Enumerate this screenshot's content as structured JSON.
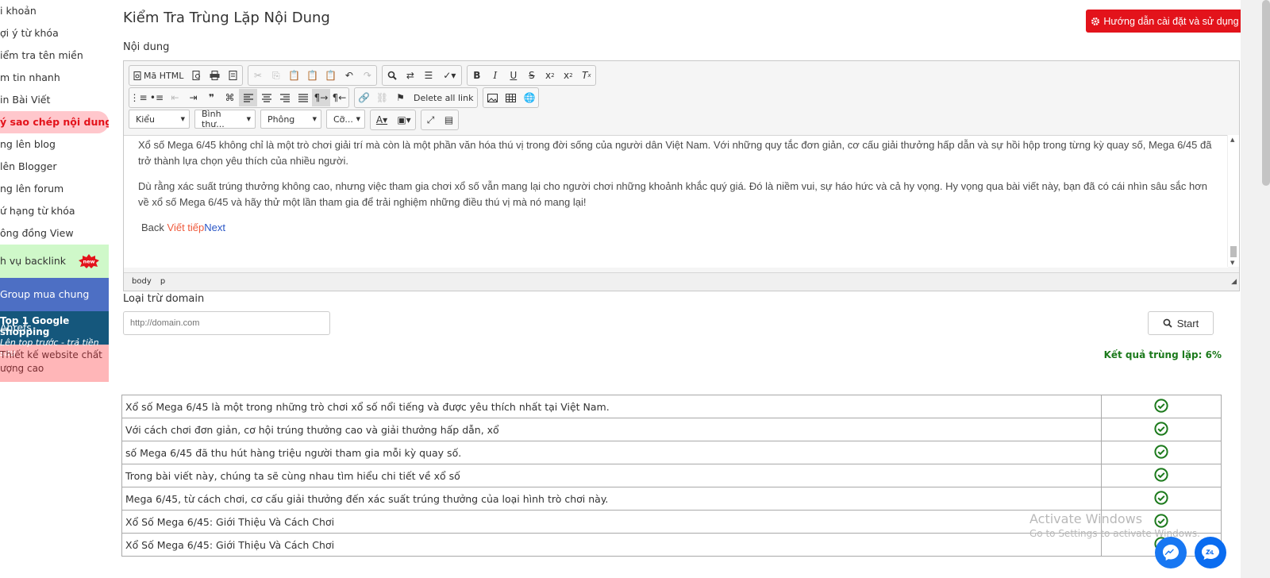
{
  "sidebar": {
    "items": [
      {
        "label": "i khoản"
      },
      {
        "label": "ợi ý từ khóa"
      },
      {
        "label": "iểm tra tên miền"
      },
      {
        "label": "m tin nhanh"
      },
      {
        "label": "in Bài Viết"
      },
      {
        "label": "ý sao chép nội dung",
        "active": true
      },
      {
        "label": "ng lên blog"
      },
      {
        "label": "lên Blogger"
      },
      {
        "label": "ng lên forum"
      },
      {
        "label": "ứ hạng từ khóa"
      },
      {
        "label": "ông đồng View"
      }
    ],
    "backlink": {
      "label": "h vụ backlink",
      "badge": "new"
    },
    "ahrefs": {
      "label": "Group mua chung Ahrefs"
    },
    "shopping": {
      "line1": "Top 1 Google shopping",
      "line2": "Lên top trước - trả tiền sau"
    },
    "website": {
      "line1": "Thiết kế website chất",
      "line2": "ượng cao"
    }
  },
  "header": {
    "title": "Kiểm Tra Trùng Lặp Nội Dung",
    "guide_button": "Hướng dẫn cài đặt và sử dụng"
  },
  "content_label": "Nội dung",
  "editor": {
    "source_button": "Mã HTML",
    "delete_links_button": "Delete all link",
    "combos": {
      "style": "Kiểu",
      "format": "Bình thư...",
      "font": "Phông",
      "size": "Cỡ..."
    },
    "paragraphs": [
      "Xổ số Mega 6/45 không chỉ là một trò chơi giải trí mà còn là một phần văn hóa thú vị trong đời sống của người dân Việt Nam. Với những quy tắc đơn giản, cơ cấu giải thưởng hấp dẫn và sự hồi hộp trong từng kỳ quay số, Mega 6/45 đã trở thành lựa chọn yêu thích của nhiều người.",
      "Dù rằng xác suất trúng thưởng không cao, nhưng việc tham gia chơi xổ số vẫn mang lại cho người chơi những khoảnh khắc quý giá. Đó là niềm vui, sự háo hức và cả hy vọng. Hy vọng qua bài viết này, bạn đã có cái nhìn sâu sắc hơn về xổ số Mega 6/45 và hãy thử một lần tham gia để trải nghiệm những điều thú vị mà nó mang lại!"
    ],
    "nav_back": "Back",
    "nav_continue": "Viết tiếp",
    "nav_next": "Next",
    "path": [
      "body",
      "p"
    ]
  },
  "exclude": {
    "label": "Loại trừ domain",
    "placeholder": "http://domain.com",
    "start_button": "Start"
  },
  "result_text": "Kết quả trùng lặp: 6%",
  "rows": [
    "Xổ số Mega 6/45 là một trong những trò chơi xổ số nổi tiếng và được yêu thích nhất tại Việt Nam.",
    "Với cách chơi đơn giản, cơ hội trúng thưởng cao và giải thưởng hấp dẫn, xổ",
    "số Mega 6/45 đã thu hút hàng triệu người tham gia mỗi kỳ quay số.",
    "Trong bài viết này, chúng ta sẽ cùng nhau tìm hiểu chi tiết về xổ số",
    "Mega 6/45, từ cách chơi, cơ cấu giải thưởng đến xác suất trúng thưởng của loại hình trò chơi này.",
    "Xổ Số Mega 6/45: Giới Thiệu Và Cách Chơi",
    "Xổ Số Mega 6/45: Giới Thiệu Và Cách Chơi"
  ],
  "watermark": {
    "line1": "Activate Windows",
    "line2": "Go to Settings to activate Windows."
  },
  "colors": {
    "accent_red": "#e3131b",
    "ok_green": "#1c7a1c",
    "ahrefs_blue": "#4d6fc4",
    "shopping_blue": "#15577c"
  }
}
